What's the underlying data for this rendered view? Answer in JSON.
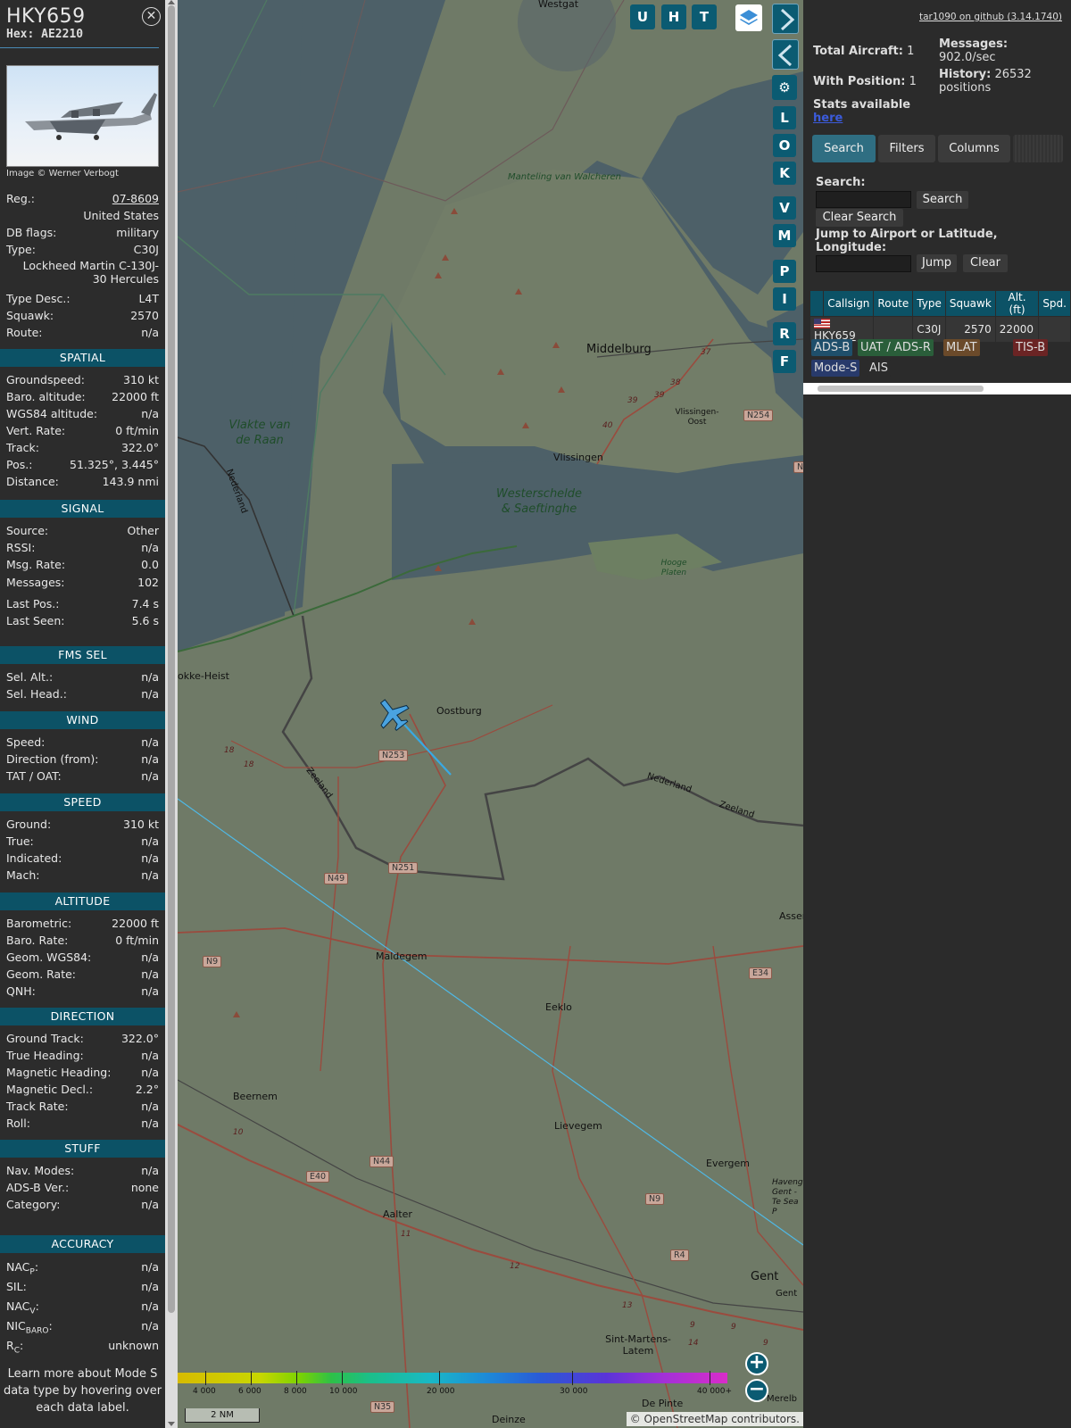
{
  "aircraft": {
    "callsign": "HKY659",
    "hex": "Hex: AE2210",
    "photo_credit": "Image © Werner Verbogt",
    "fields": [
      {
        "label": "Reg.:",
        "value": "07-8609"
      },
      {
        "label": "",
        "value": "United States"
      },
      {
        "label": "DB flags:",
        "value": "military"
      },
      {
        "label": "Type:",
        "value": "C30J"
      },
      {
        "label": "",
        "value": "Lockheed Martin C-130J-30 Hercules"
      },
      {
        "label": "Type Desc.:",
        "value": "L4T"
      },
      {
        "label": "Squawk:",
        "value": "2570"
      },
      {
        "label": "Route:",
        "value": "n/a"
      }
    ]
  },
  "sections": {
    "spatial": {
      "title": "SPATIAL",
      "rows": [
        {
          "label": "Groundspeed:",
          "value": "310 kt"
        },
        {
          "label": "Baro. altitude:",
          "value": "22000 ft"
        },
        {
          "label": "WGS84 altitude:",
          "value": "n/a"
        },
        {
          "label": "Vert. Rate:",
          "value": "0 ft/min"
        },
        {
          "label": "Track:",
          "value": "322.0°"
        },
        {
          "label": "Pos.:",
          "value": "51.325°, 3.445°"
        },
        {
          "label": "Distance:",
          "value": "143.9 nmi"
        }
      ]
    },
    "signal": {
      "title": "SIGNAL",
      "rows": [
        {
          "label": "Source:",
          "value": "Other"
        },
        {
          "label": "RSSI:",
          "value": "n/a"
        },
        {
          "label": "Msg. Rate:",
          "value": "0.0"
        },
        {
          "label": "Messages:",
          "value": "102"
        },
        {
          "label": "Last Pos.:",
          "value": "7.4 s"
        },
        {
          "label": "Last Seen:",
          "value": "5.6 s"
        }
      ]
    },
    "fms": {
      "title": "FMS SEL",
      "rows": [
        {
          "label": "Sel. Alt.:",
          "value": "n/a"
        },
        {
          "label": "Sel. Head.:",
          "value": "n/a"
        }
      ]
    },
    "wind": {
      "title": "WIND",
      "rows": [
        {
          "label": "Speed:",
          "value": "n/a"
        },
        {
          "label": "Direction (from):",
          "value": "n/a"
        },
        {
          "label": "TAT / OAT:",
          "value": "n/a"
        }
      ]
    },
    "speed": {
      "title": "SPEED",
      "rows": [
        {
          "label": "Ground:",
          "value": "310 kt"
        },
        {
          "label": "True:",
          "value": "n/a"
        },
        {
          "label": "Indicated:",
          "value": "n/a"
        },
        {
          "label": "Mach:",
          "value": "n/a"
        }
      ]
    },
    "altitude": {
      "title": "ALTITUDE",
      "rows": [
        {
          "label": "Barometric:",
          "value": "22000 ft"
        },
        {
          "label": "Baro. Rate:",
          "value": "0 ft/min"
        },
        {
          "label": "Geom. WGS84:",
          "value": "n/a"
        },
        {
          "label": "Geom. Rate:",
          "value": "n/a"
        },
        {
          "label": "QNH:",
          "value": "n/a"
        }
      ]
    },
    "direction": {
      "title": "DIRECTION",
      "rows": [
        {
          "label": "Ground Track:",
          "value": "322.0°"
        },
        {
          "label": "True Heading:",
          "value": "n/a"
        },
        {
          "label": "Magnetic Heading:",
          "value": "n/a"
        },
        {
          "label": "Magnetic Decl.:",
          "value": "2.2°"
        },
        {
          "label": "Track Rate:",
          "value": "n/a"
        },
        {
          "label": "Roll:",
          "value": "n/a"
        }
      ]
    },
    "stuff": {
      "title": "STUFF",
      "rows": [
        {
          "label": "Nav. Modes:",
          "value": "n/a"
        },
        {
          "label": "ADS-B Ver.:",
          "value": "none"
        },
        {
          "label": "Category:",
          "value": "n/a"
        }
      ]
    },
    "accuracy": {
      "title": "ACCURACY",
      "rows": [
        {
          "label": "NAC",
          "sub": "P",
          "value": "n/a"
        },
        {
          "label": "SIL:",
          "sub": "",
          "value": "n/a"
        },
        {
          "label": "NAC",
          "sub": "V",
          "value": "n/a"
        },
        {
          "label": "NIC",
          "sub": "BARO",
          "value": "n/a"
        },
        {
          "label": "R",
          "sub": "C",
          "value": "unknown"
        }
      ]
    }
  },
  "learn_more": "Learn more about Mode S data type by hovering over each data label.",
  "map": {
    "buttons_top": [
      "U",
      "H",
      "T"
    ],
    "buttons_side": [
      "L",
      "O",
      "K",
      "V",
      "M",
      "P",
      "I",
      "R",
      "F"
    ],
    "labels": {
      "westgat": "Westgat",
      "manteling": "Manteling van Walcheren",
      "middelburg": "Middelburg",
      "vlissingen": "Vlissingen",
      "vlissingen_oost": "Vlissingen-Oost",
      "vlakte": "Vlakte van de Raan",
      "westerschelde": "Westerschelde & Saeftinghe",
      "hooge_platen": "Hooge Platen",
      "knokke": "okke-Heist",
      "oostburg": "Oostburg",
      "maldegem": "Maldegem",
      "eeklo": "Eeklo",
      "beernem": "Beernem",
      "lievegem": "Lievegem",
      "aalter": "Aalter",
      "evergem": "Evergem",
      "gent": "Gent",
      "sint_martens": "Sint-Martens-Latem",
      "de_pinte": "De Pinte",
      "deinze": "Deinze",
      "asse": "Asser",
      "merelb": "Merelb",
      "nederland1": "Nederland",
      "nederland2": "Nederland",
      "zeeland1": "Zeeland",
      "zeeland2": "Zeeland",
      "hovenge": "Havenge Gent - Te Sea P",
      "gent2": "Gent"
    },
    "roads": {
      "n253": "N253",
      "n251": "N251",
      "n49": "N49",
      "n9a": "N9",
      "n9b": "N9",
      "n44": "N44",
      "e40": "E40",
      "e34": "E34",
      "n254": "N254",
      "r4": "R4",
      "n35": "N35",
      "n_cut": "N"
    },
    "route_nums": [
      "37",
      "38",
      "39",
      "39",
      "40",
      "18",
      "18",
      "10",
      "11",
      "12",
      "13",
      "14",
      "9",
      "9",
      "9"
    ],
    "altitude_legend": [
      "4 000",
      "6 000",
      "8 000",
      "10 000",
      "20 000",
      "30 000",
      "40 000+"
    ],
    "scale": "2 NM",
    "attribution": "© OpenStreetMap contributors.",
    "zoom_in": "+",
    "zoom_out": "−"
  },
  "side": {
    "github": "tar1090 on github (3.14.1740)",
    "total_aircraft_label": "Total Aircraft:",
    "total_aircraft": "1",
    "with_position_label": "With Position:",
    "with_position": "1",
    "messages_label": "Messages:",
    "messages": "902.0/sec",
    "history_label": "History:",
    "history": "26532 positions",
    "stats_label": "Stats available",
    "stats_link": "here",
    "tabs": [
      "Search",
      "Filters",
      "Columns"
    ],
    "search_label": "Search:",
    "search_button": "Search",
    "clear_search": "Clear Search",
    "jump_label": "Jump to Airport or Latitude, Longitude:",
    "jump_button": "Jump",
    "clear_button": "Clear",
    "table": {
      "headers": [
        "",
        "Callsign",
        "Route",
        "Type",
        "Squawk",
        "Alt. (ft)",
        "Spd."
      ],
      "rows": [
        {
          "callsign": "HKY659",
          "route": "",
          "type": "C30J",
          "squawk": "2570",
          "alt": "22000",
          "spd": ""
        }
      ]
    },
    "legend": [
      {
        "label": "ADS-B",
        "color": "#1f4f6b"
      },
      {
        "label": "UAT / ADS-R",
        "color": "#2a5e3a"
      },
      {
        "label": "MLAT",
        "color": "#6b4a2a"
      },
      {
        "label": "TIS-B",
        "color": "#6b2424"
      },
      {
        "label": "Mode-S",
        "color": "#283a6b"
      },
      {
        "label": "AIS",
        "color": "#2b2b2b"
      }
    ]
  }
}
